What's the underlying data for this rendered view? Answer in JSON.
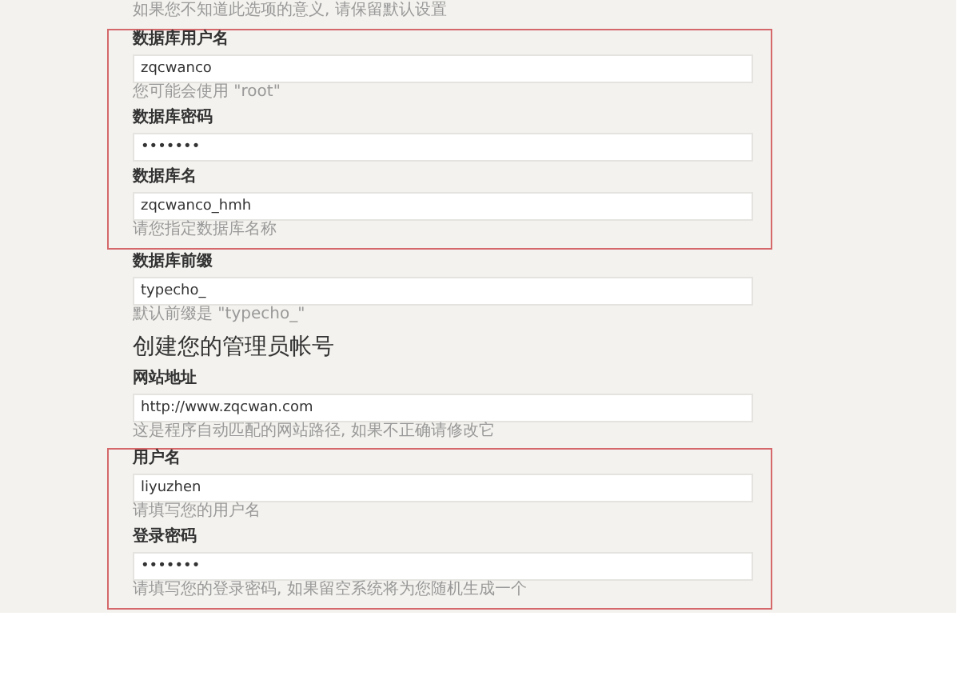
{
  "groups": [
    {
      "highlighted": false,
      "items": [
        {
          "kind": "note",
          "text": "如果您不知道此选项的意义, 请保留默认设置"
        }
      ]
    },
    {
      "highlighted": true,
      "items": [
        {
          "kind": "field",
          "label": "数据库用户名",
          "value": "zqcwanco",
          "hint": "您可能会使用 \"root\""
        },
        {
          "kind": "field",
          "label": "数据库密码",
          "value": "•••••••"
        },
        {
          "kind": "field",
          "label": "数据库名",
          "value": "zqcwanco_hmh",
          "hint": "请您指定数据库名称"
        }
      ]
    },
    {
      "highlighted": false,
      "items": [
        {
          "kind": "field",
          "label": "数据库前缀",
          "value": "typecho_",
          "hint": "默认前缀是 \"typecho_\""
        },
        {
          "kind": "heading",
          "text": "创建您的管理员帐号"
        },
        {
          "kind": "field",
          "label": "网站地址",
          "value": "http://www.zqcwan.com",
          "hint": "这是程序自动匹配的网站路径, 如果不正确请修改它"
        }
      ]
    },
    {
      "highlighted": true,
      "items": [
        {
          "kind": "field",
          "label": "用户名",
          "value": "liyuzhen",
          "hint": "请填写您的用户名"
        },
        {
          "kind": "field",
          "label": "登录密码",
          "value": "•••••••",
          "hint": "请填写您的登录密码, 如果留空系统将为您随机生成一个"
        }
      ]
    }
  ]
}
